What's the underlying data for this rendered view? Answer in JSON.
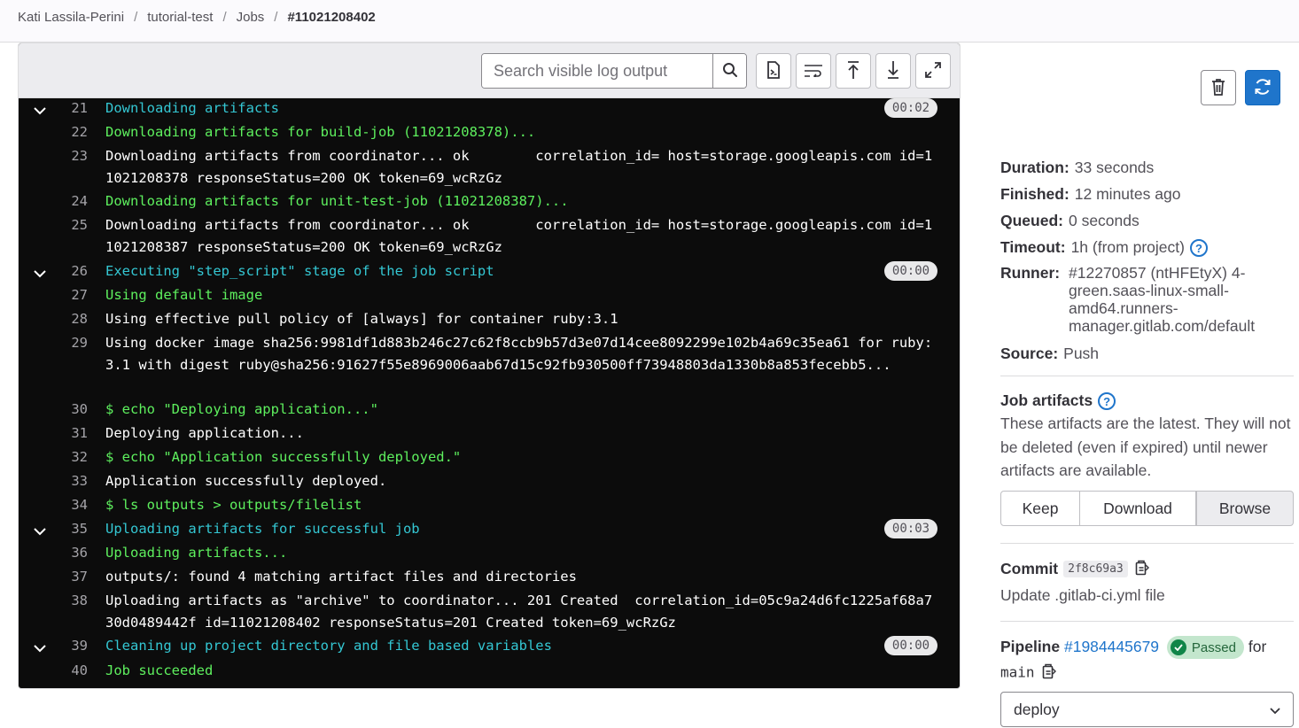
{
  "breadcrumb": [
    "Kati Lassila-Perini",
    "tutorial-test",
    "Jobs",
    "#11021208402"
  ],
  "log_toolbar": {
    "search_placeholder": "Search visible log output",
    "buttons": [
      "search-icon",
      "raw-log-icon",
      "line-wrap-icon",
      "scroll-top-icon",
      "scroll-bottom-icon",
      "fullscreen-icon"
    ]
  },
  "log": [
    {
      "n": "21",
      "text": "Downloading artifacts",
      "color": "cyan",
      "section": true,
      "duration": "00:02"
    },
    {
      "n": "22",
      "text": "Downloading artifacts for build-job (11021208378)...",
      "color": "green"
    },
    {
      "n": "23",
      "text": "Downloading artifacts from coordinator... ok        correlation_id= host=storage.googleapis.com id=11021208378 responseStatus=200 OK token=69_wcRzGz",
      "color": "white"
    },
    {
      "n": "24",
      "text": "Downloading artifacts for unit-test-job (11021208387)...",
      "color": "green"
    },
    {
      "n": "25",
      "text": "Downloading artifacts from coordinator... ok        correlation_id= host=storage.googleapis.com id=11021208387 responseStatus=200 OK token=69_wcRzGz",
      "color": "white"
    },
    {
      "n": "26",
      "text": "Executing \"step_script\" stage of the job script",
      "color": "cyan",
      "section": true,
      "duration": "00:00"
    },
    {
      "n": "27",
      "text": "Using default image",
      "color": "green"
    },
    {
      "n": "28",
      "text": "Using effective pull policy of [always] for container ruby:3.1",
      "color": "white"
    },
    {
      "n": "29",
      "text": "Using docker image sha256:9981df1d883b246c27c62f8ccb9b57d3e07d14cee8092299e102b4a69c35ea61 for ruby:3.1 with digest ruby@sha256:91627f55e8969006aab67d15c92fb930500ff73948803da1330b8a853fecebb5...",
      "color": "white"
    },
    {
      "n": "30",
      "text": "$ echo \"Deploying application...\"",
      "color": "green"
    },
    {
      "n": "31",
      "text": "Deploying application...",
      "color": "white"
    },
    {
      "n": "32",
      "text": "$ echo \"Application successfully deployed.\"",
      "color": "green"
    },
    {
      "n": "33",
      "text": "Application successfully deployed.",
      "color": "white"
    },
    {
      "n": "34",
      "text": "$ ls outputs > outputs/filelist",
      "color": "green"
    },
    {
      "n": "35",
      "text": "Uploading artifacts for successful job",
      "color": "cyan",
      "section": true,
      "duration": "00:03"
    },
    {
      "n": "36",
      "text": "Uploading artifacts...",
      "color": "green"
    },
    {
      "n": "37",
      "text": "outputs/: found 4 matching artifact files and directories",
      "color": "white"
    },
    {
      "n": "38",
      "text": "Uploading artifacts as \"archive\" to coordinator... 201 Created  correlation_id=05c9a24d6fc1225af68a730d0489442f id=11021208402 responseStatus=201 Created token=69_wcRzGz",
      "color": "white"
    },
    {
      "n": "39",
      "text": "Cleaning up project directory and file based variables",
      "color": "cyan",
      "section": true,
      "duration": "00:00"
    },
    {
      "n": "40",
      "text": "Job succeeded",
      "color": "green"
    }
  ],
  "sidebar": {
    "duration_label": "Duration:",
    "duration": "33 seconds",
    "finished_label": "Finished:",
    "finished": "12 minutes ago",
    "queued_label": "Queued:",
    "queued": "0 seconds",
    "timeout_label": "Timeout:",
    "timeout": "1h (from project)",
    "runner_label": "Runner:",
    "runner": "#12270857 (ntHFEtyX) 4-green.saas-linux-small-amd64.runners-manager.gitlab.com/default",
    "source_label": "Source:",
    "source": "Push",
    "artifacts_title": "Job artifacts",
    "artifacts_text": "These artifacts are the latest. They will not be deleted (even if expired) until newer artifacts are available.",
    "keep": "Keep",
    "download": "Download",
    "browse": "Browse",
    "commit_label": "Commit",
    "commit_sha": "2f8c69a3",
    "commit_message": "Update .gitlab-ci.yml file",
    "pipeline_label": "Pipeline",
    "pipeline_id": "#1984445679",
    "pipeline_status": "Passed",
    "for_label": "for",
    "branch": "main",
    "stage": "deploy"
  },
  "colors": {
    "cyan": "#34c7d3",
    "green": "#5ef05e",
    "white": "#ffffff",
    "accent": "#1f75cb",
    "success": "#108548"
  }
}
